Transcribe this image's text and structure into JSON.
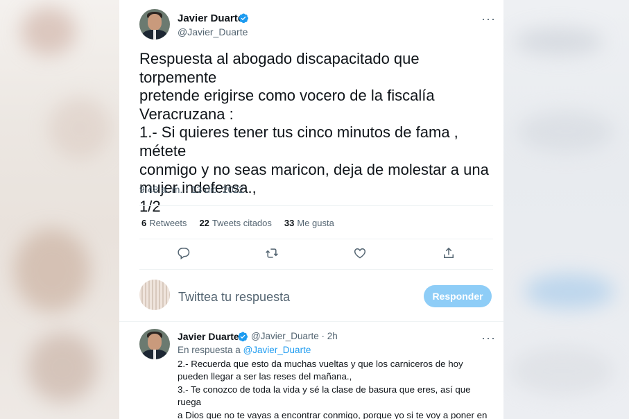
{
  "tweet": {
    "author_name": "Javier Duarte",
    "author_handle": "@Javier_Duarte",
    "text": "Respuesta al abogado discapacitado que torpemente\npretende erigirse como vocero de la fiscalía\nVeracruzana :\n1.- Si quieres tener tus cinco minutos de fama , métete\nconmigo y no seas maricon, deja de molestar a una\nmujer indefensa.,\n1/2",
    "timestamp": "9:48 a. m. · 13 dic. 2022",
    "stats": {
      "retweets_count": "6",
      "retweets_label": "Retweets",
      "quotes_count": "22",
      "quotes_label": "Tweets citados",
      "likes_count": "33",
      "likes_label": "Me gusta"
    },
    "more_label": "···"
  },
  "compose": {
    "placeholder": "Twittea tu respuesta",
    "button_label": "Responder"
  },
  "reply_tweet": {
    "author_name": "Javier Duarte",
    "author_handle": "@Javier_Duarte",
    "separator": "·",
    "time": "2h",
    "in_reply_prefix": "En respuesta a",
    "in_reply_handle": "@Javier_Duarte",
    "text": "2.- Recuerda que esto da muchas vueltas y que los carniceros de hoy\npueden llegar a ser las reses del mañana.,\n3.- Te conozco de toda la vida y sé la clase de basura que eres, así que ruega\na Dios que no te vayas a encontrar conmigo, porque yo si te voy a poner en\ntu lugar.",
    "more_label": "···"
  },
  "colors": {
    "accent": "#1d9bf0",
    "button_disabled": "#8ecdf7",
    "secondary_text": "#536471"
  },
  "icons": {
    "verified": "verified-badge-icon",
    "reply": "reply-icon",
    "retweet": "retweet-icon",
    "like": "heart-icon",
    "share": "share-icon"
  }
}
